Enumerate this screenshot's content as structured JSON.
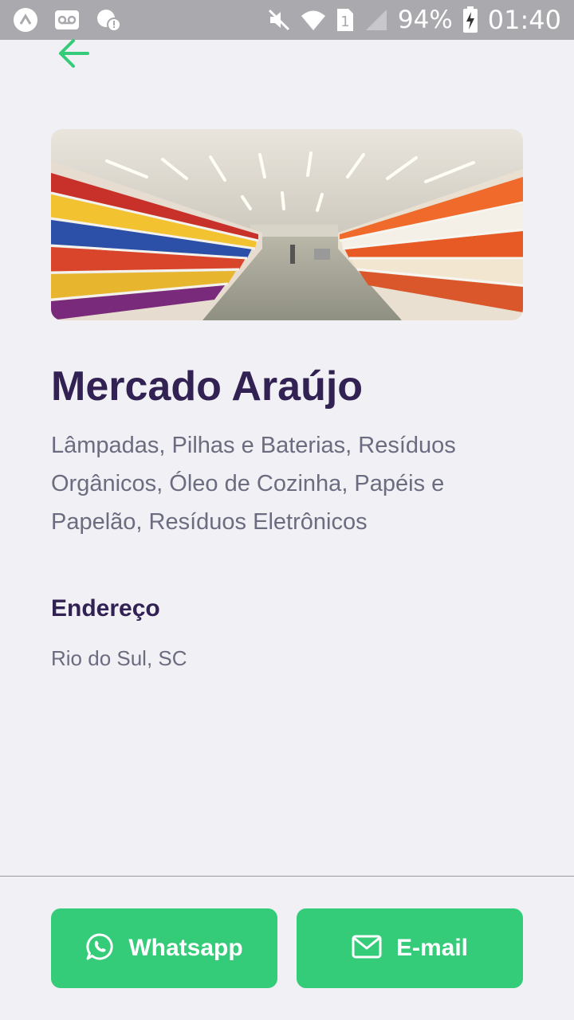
{
  "status_bar": {
    "battery": "94%",
    "time": "01:40",
    "sim_slot": "1",
    "icons": [
      "android-icon",
      "voicemail-icon",
      "wifi-alert-icon",
      "mute-icon",
      "wifi-icon",
      "sim-icon",
      "signal-icon",
      "battery-charging-icon"
    ]
  },
  "point": {
    "name": "Mercado Araújo",
    "items": "Lâmpadas, Pilhas e Baterias, Resíduos Orgânicos, Óleo de Cozinha, Papéis e Papelão, Resíduos Eletrônicos",
    "address_title": "Endereço",
    "address": "Rio do Sul, SC"
  },
  "actions": {
    "whatsapp_label": "Whatsapp",
    "email_label": "E-mail"
  },
  "colors": {
    "primary": "#34cb79",
    "title": "#322153",
    "text": "#6c6c80",
    "background": "#f0f0f5"
  }
}
